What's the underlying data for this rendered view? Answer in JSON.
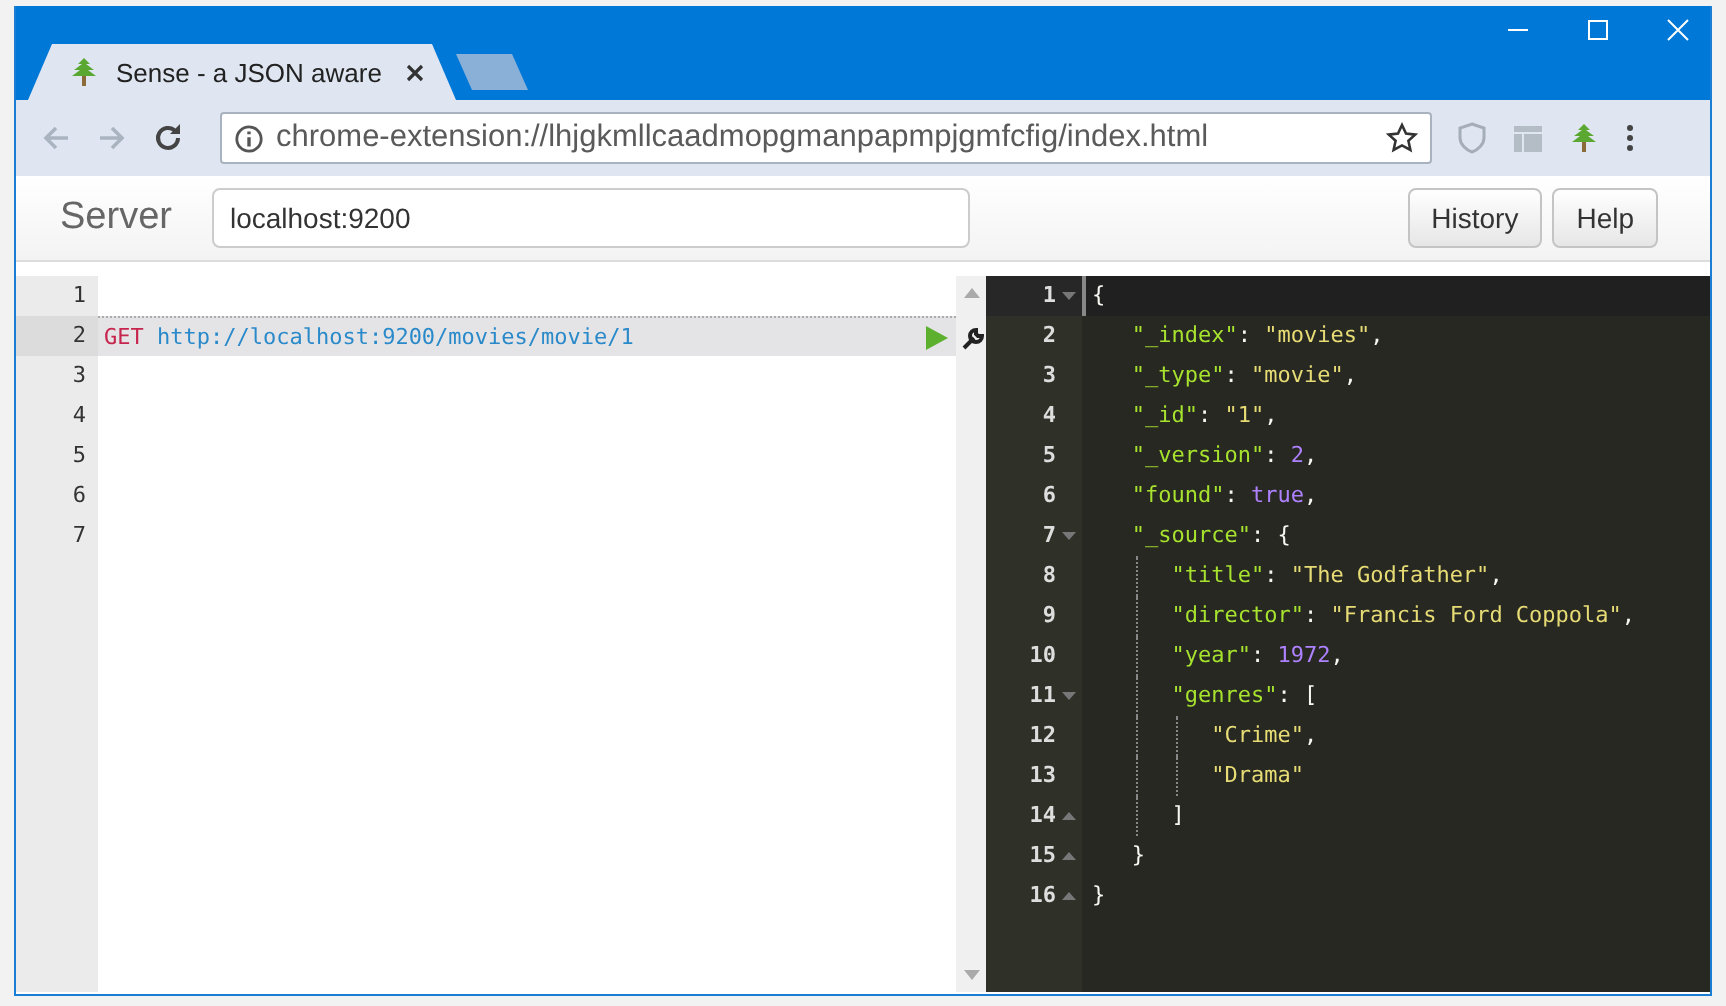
{
  "tabs": [
    {
      "title": "Sense - a JSON aware",
      "selected": true
    },
    {
      "selected": false
    }
  ],
  "address": "chrome-extension://lhjgkmllcaadmopgmanpapmpjgmfcfig/index.html",
  "server": {
    "label": "Server",
    "value": "localhost:9200"
  },
  "buttons": [
    "History",
    "Help"
  ],
  "request": [
    {
      "number": "1",
      "active": false
    },
    {
      "number": "2",
      "active": true,
      "tokens": [
        {
          "kind": "method",
          "text": "GET"
        },
        {
          "kind": "url",
          "text": "http://localhost:9200/movies/movie/1"
        }
      ]
    },
    {
      "number": "3",
      "active": false
    },
    {
      "number": "4",
      "active": false
    },
    {
      "number": "5",
      "active": false
    },
    {
      "number": "6",
      "active": false
    },
    {
      "number": "7",
      "active": false
    }
  ],
  "response": [
    {
      "number": "1",
      "active": true,
      "fold_start": true,
      "fold_end": false,
      "tokens": [
        {
          "kind": "punct",
          "text": "{"
        }
      ]
    },
    {
      "number": "2",
      "active": false,
      "fold_start": false,
      "fold_end": false,
      "tokens": [
        {
          "kind": "key",
          "text": "   \"_index\""
        },
        {
          "kind": "punct",
          "text": ": "
        },
        {
          "kind": "string",
          "text": "\"movies\""
        },
        {
          "kind": "punct",
          "text": ","
        }
      ]
    },
    {
      "number": "3",
      "active": false,
      "fold_start": false,
      "fold_end": false,
      "tokens": [
        {
          "kind": "key",
          "text": "   \"_type\""
        },
        {
          "kind": "punct",
          "text": ": "
        },
        {
          "kind": "string",
          "text": "\"movie\""
        },
        {
          "kind": "punct",
          "text": ","
        }
      ]
    },
    {
      "number": "4",
      "active": false,
      "fold_start": false,
      "fold_end": false,
      "tokens": [
        {
          "kind": "key",
          "text": "   \"_id\""
        },
        {
          "kind": "punct",
          "text": ": "
        },
        {
          "kind": "string",
          "text": "\"1\""
        },
        {
          "kind": "punct",
          "text": ","
        }
      ]
    },
    {
      "number": "5",
      "active": false,
      "fold_start": false,
      "fold_end": false,
      "tokens": [
        {
          "kind": "key",
          "text": "   \"_version\""
        },
        {
          "kind": "punct",
          "text": ": "
        },
        {
          "kind": "number",
          "text": "2"
        },
        {
          "kind": "punct",
          "text": ","
        }
      ]
    },
    {
      "number": "6",
      "active": false,
      "fold_start": false,
      "fold_end": false,
      "tokens": [
        {
          "kind": "key",
          "text": "   \"found\""
        },
        {
          "kind": "punct",
          "text": ": "
        },
        {
          "kind": "number",
          "text": "true"
        },
        {
          "kind": "punct",
          "text": ","
        }
      ]
    },
    {
      "number": "7",
      "active": false,
      "fold_start": true,
      "fold_end": false,
      "tokens": [
        {
          "kind": "key",
          "text": "   \"_source\""
        },
        {
          "kind": "punct",
          "text": ": {"
        }
      ]
    },
    {
      "number": "8",
      "active": false,
      "fold_start": false,
      "fold_end": false,
      "tokens": [
        {
          "kind": "key",
          "text": "      \"title\""
        },
        {
          "kind": "punct",
          "text": ": "
        },
        {
          "kind": "string",
          "text": "\"The Godfather\""
        },
        {
          "kind": "punct",
          "text": ","
        }
      ]
    },
    {
      "number": "9",
      "active": false,
      "fold_start": false,
      "fold_end": false,
      "tokens": [
        {
          "kind": "key",
          "text": "      \"director\""
        },
        {
          "kind": "punct",
          "text": ": "
        },
        {
          "kind": "string",
          "text": "\"Francis Ford Coppola\""
        },
        {
          "kind": "punct",
          "text": ","
        }
      ]
    },
    {
      "number": "10",
      "active": false,
      "fold_start": false,
      "fold_end": false,
      "tokens": [
        {
          "kind": "key",
          "text": "      \"year\""
        },
        {
          "kind": "punct",
          "text": ": "
        },
        {
          "kind": "number",
          "text": "1972"
        },
        {
          "kind": "punct",
          "text": ","
        }
      ]
    },
    {
      "number": "11",
      "active": false,
      "fold_start": true,
      "fold_end": false,
      "tokens": [
        {
          "kind": "key",
          "text": "      \"genres\""
        },
        {
          "kind": "punct",
          "text": ": ["
        }
      ]
    },
    {
      "number": "12",
      "active": false,
      "fold_start": false,
      "fold_end": false,
      "tokens": [
        {
          "kind": "string",
          "text": "         \"Crime\""
        },
        {
          "kind": "punct",
          "text": ","
        }
      ]
    },
    {
      "number": "13",
      "active": false,
      "fold_start": false,
      "fold_end": false,
      "tokens": [
        {
          "kind": "string",
          "text": "         \"Drama\""
        }
      ]
    },
    {
      "number": "14",
      "active": false,
      "fold_start": false,
      "fold_end": true,
      "tokens": [
        {
          "kind": "punct",
          "text": "      ]"
        }
      ]
    },
    {
      "number": "15",
      "active": false,
      "fold_start": false,
      "fold_end": true,
      "tokens": [
        {
          "kind": "punct",
          "text": "   }"
        }
      ]
    },
    {
      "number": "16",
      "active": false,
      "fold_start": false,
      "fold_end": true,
      "tokens": [
        {
          "kind": "punct",
          "text": "}"
        }
      ]
    }
  ]
}
